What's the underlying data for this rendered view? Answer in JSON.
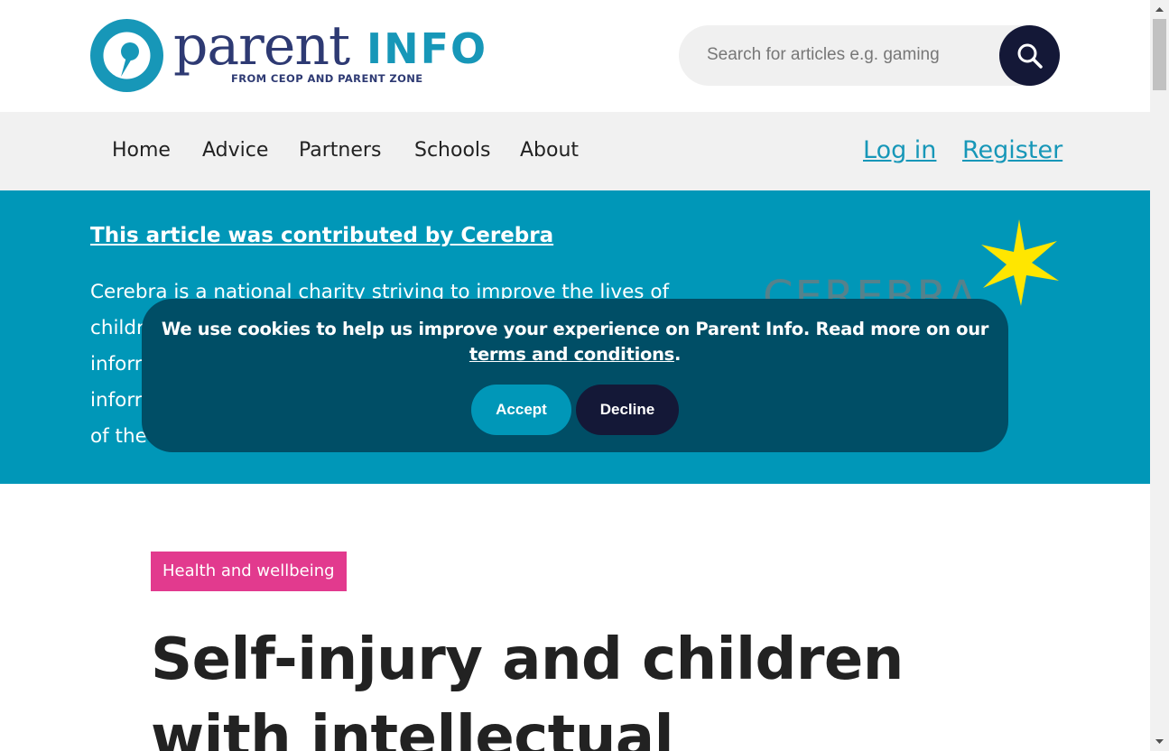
{
  "header": {
    "logo": {
      "word": "parent",
      "suffix": "INFO",
      "tagline": "FROM CEOP AND PARENT ZONE"
    },
    "search": {
      "placeholder": "Search for articles e.g. gaming",
      "button_icon": "search-icon"
    }
  },
  "nav": {
    "items": [
      {
        "label": "Home"
      },
      {
        "label": "Advice"
      },
      {
        "label": "Partners"
      },
      {
        "label": "Schools"
      },
      {
        "label": "About"
      }
    ],
    "login": "Log in",
    "register": "Register"
  },
  "banner": {
    "title": "This article was contributed by Cerebra",
    "lines": [
      "Cerebra is a national charity striving to improve the lives of",
      "childr",
      "inforr",
      "inforr",
      "of the"
    ],
    "partner_logo_text": "CEREBRA"
  },
  "cookie": {
    "text": "We use cookies to help us improve your experience on Parent Info. Read more on our ",
    "link": "terms and conditions",
    "end": ".",
    "accept": "Accept",
    "decline": "Decline"
  },
  "article": {
    "tag": "Health and wellbeing",
    "title": "Self-injury and children with intellectual"
  },
  "colors": {
    "brand_teal": "#0097b8",
    "brand_navy": "#141837",
    "cookie_bg": "#004e66",
    "tag_pink": "#e23a8e"
  }
}
